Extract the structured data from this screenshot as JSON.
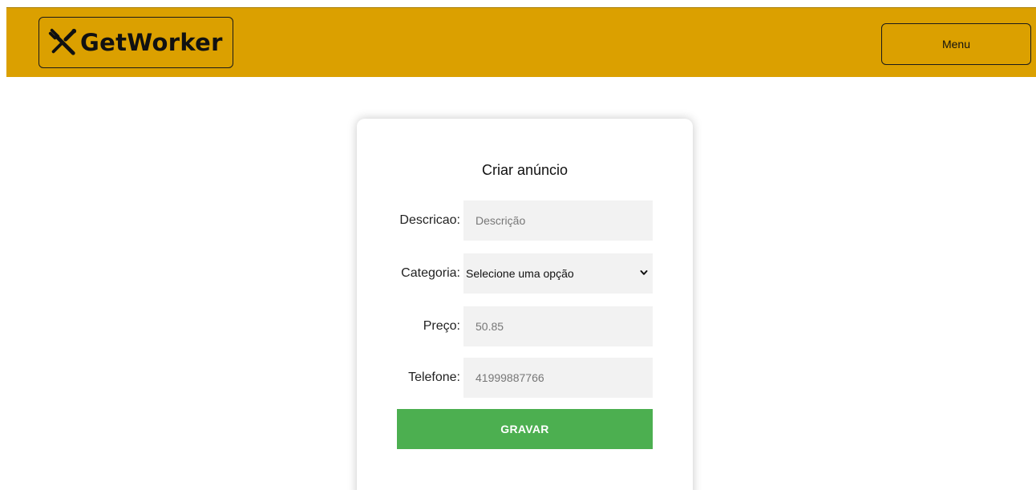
{
  "header": {
    "logo_text": "GetWorker",
    "logo_icon": "tools-icon",
    "menu_label": "Menu",
    "background_color": "#dba000"
  },
  "form": {
    "title": "Criar anúncio",
    "fields": [
      {
        "label": "Descricao:",
        "placeholder": "Descrição",
        "value": ""
      },
      {
        "label": "Categoria:",
        "selected": "Selecione uma opção"
      },
      {
        "label": "Preço:",
        "placeholder": "50.85",
        "value": ""
      },
      {
        "label": "Telefone:",
        "placeholder": "41999887766",
        "value": ""
      }
    ],
    "submit_label": "GRAVAR",
    "submit_color": "#4caf50"
  }
}
